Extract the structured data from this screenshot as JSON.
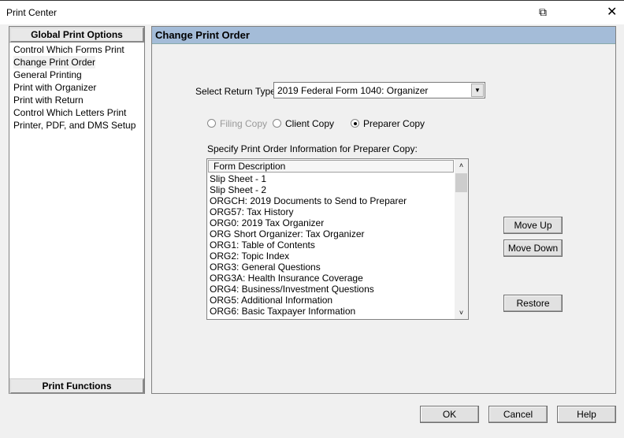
{
  "window": {
    "title": "Print Center"
  },
  "left_panel": {
    "header": "Global Print Options",
    "items": [
      "Control Which Forms Print",
      "Change Print Order",
      "General Printing",
      "Print with Organizer",
      "Print with Return",
      "Control Which Letters Print",
      "Printer, PDF, and DMS Setup"
    ],
    "selected": "Change Print Order",
    "footer": "Print Functions"
  },
  "main": {
    "title": "Change Print Order",
    "return_type_label": "Select Return Type:",
    "return_type_value": "2019 Federal Form 1040: Organizer",
    "copies": [
      {
        "label": "Filing Copy",
        "selected": false,
        "disabled": true
      },
      {
        "label": "Client Copy",
        "selected": false,
        "disabled": false
      },
      {
        "label": "Preparer Copy",
        "selected": true,
        "disabled": false
      }
    ],
    "list_label": "Specify Print Order Information for Preparer Copy:",
    "list_header": "Form Description",
    "rows": [
      "Slip Sheet - 1",
      "Slip Sheet - 2",
      "ORGCH: 2019 Documents to Send to Preparer",
      "ORG57: Tax History",
      "ORG0: 2019 Tax Organizer",
      "ORG Short Organizer: Tax Organizer",
      "ORG1: Table of Contents",
      "ORG2: Topic Index",
      "ORG3: General Questions",
      "ORG3A: Health Insurance Coverage",
      "ORG4: Business/Investment Questions",
      "ORG5: Additional Information",
      "ORG6: Basic Taxpayer Information"
    ],
    "move_up": "Move Up",
    "move_down": "Move Down",
    "restore": "Restore"
  },
  "footer": {
    "ok": "OK",
    "cancel": "Cancel",
    "help": "Help"
  }
}
